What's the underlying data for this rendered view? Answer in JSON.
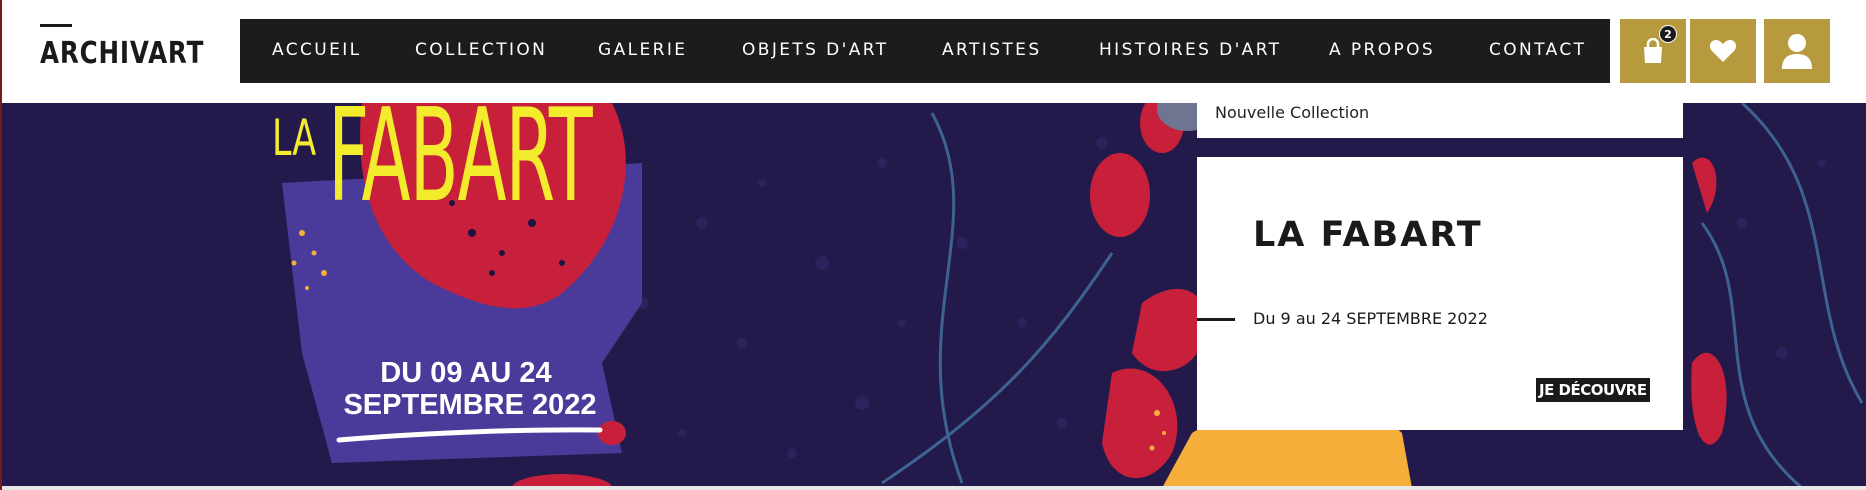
{
  "header": {
    "logo": "ARCHIVART",
    "nav": [
      {
        "label": "ACCUEIL"
      },
      {
        "label": "COLLECTION"
      },
      {
        "label": "GALERIE"
      },
      {
        "label": "OBJETS D'ART"
      },
      {
        "label": "ARTISTES"
      },
      {
        "label": "HISTOIRES D'ART"
      },
      {
        "label": "A PROPOS"
      },
      {
        "label": "CONTACT"
      }
    ],
    "cart_count": "2",
    "icons": [
      "shopping-bag-icon",
      "heart-icon",
      "user-icon"
    ]
  },
  "hero": {
    "poster_title_prefix": "LA",
    "poster_title": "FABART",
    "poster_date_line1": "DU 09 AU 24",
    "poster_date_line2": "SEPTEMBRE 2022",
    "colors": {
      "background": "#231a4b",
      "title": "#f2ec2c",
      "red_shapes": "#c8203a",
      "purple_shapes": "#4a3b9a",
      "yellow_shape": "#f6ae3a"
    }
  },
  "cards": {
    "top_label": "Nouvelle Collection",
    "title": "LA FABART",
    "date": "Du 9 au 24 SEPTEMBRE 2022",
    "cta": "JE DÉCOUVRE"
  },
  "colors": {
    "accent_gold": "#b89a3e",
    "nav_bg": "#1c1c1c"
  }
}
